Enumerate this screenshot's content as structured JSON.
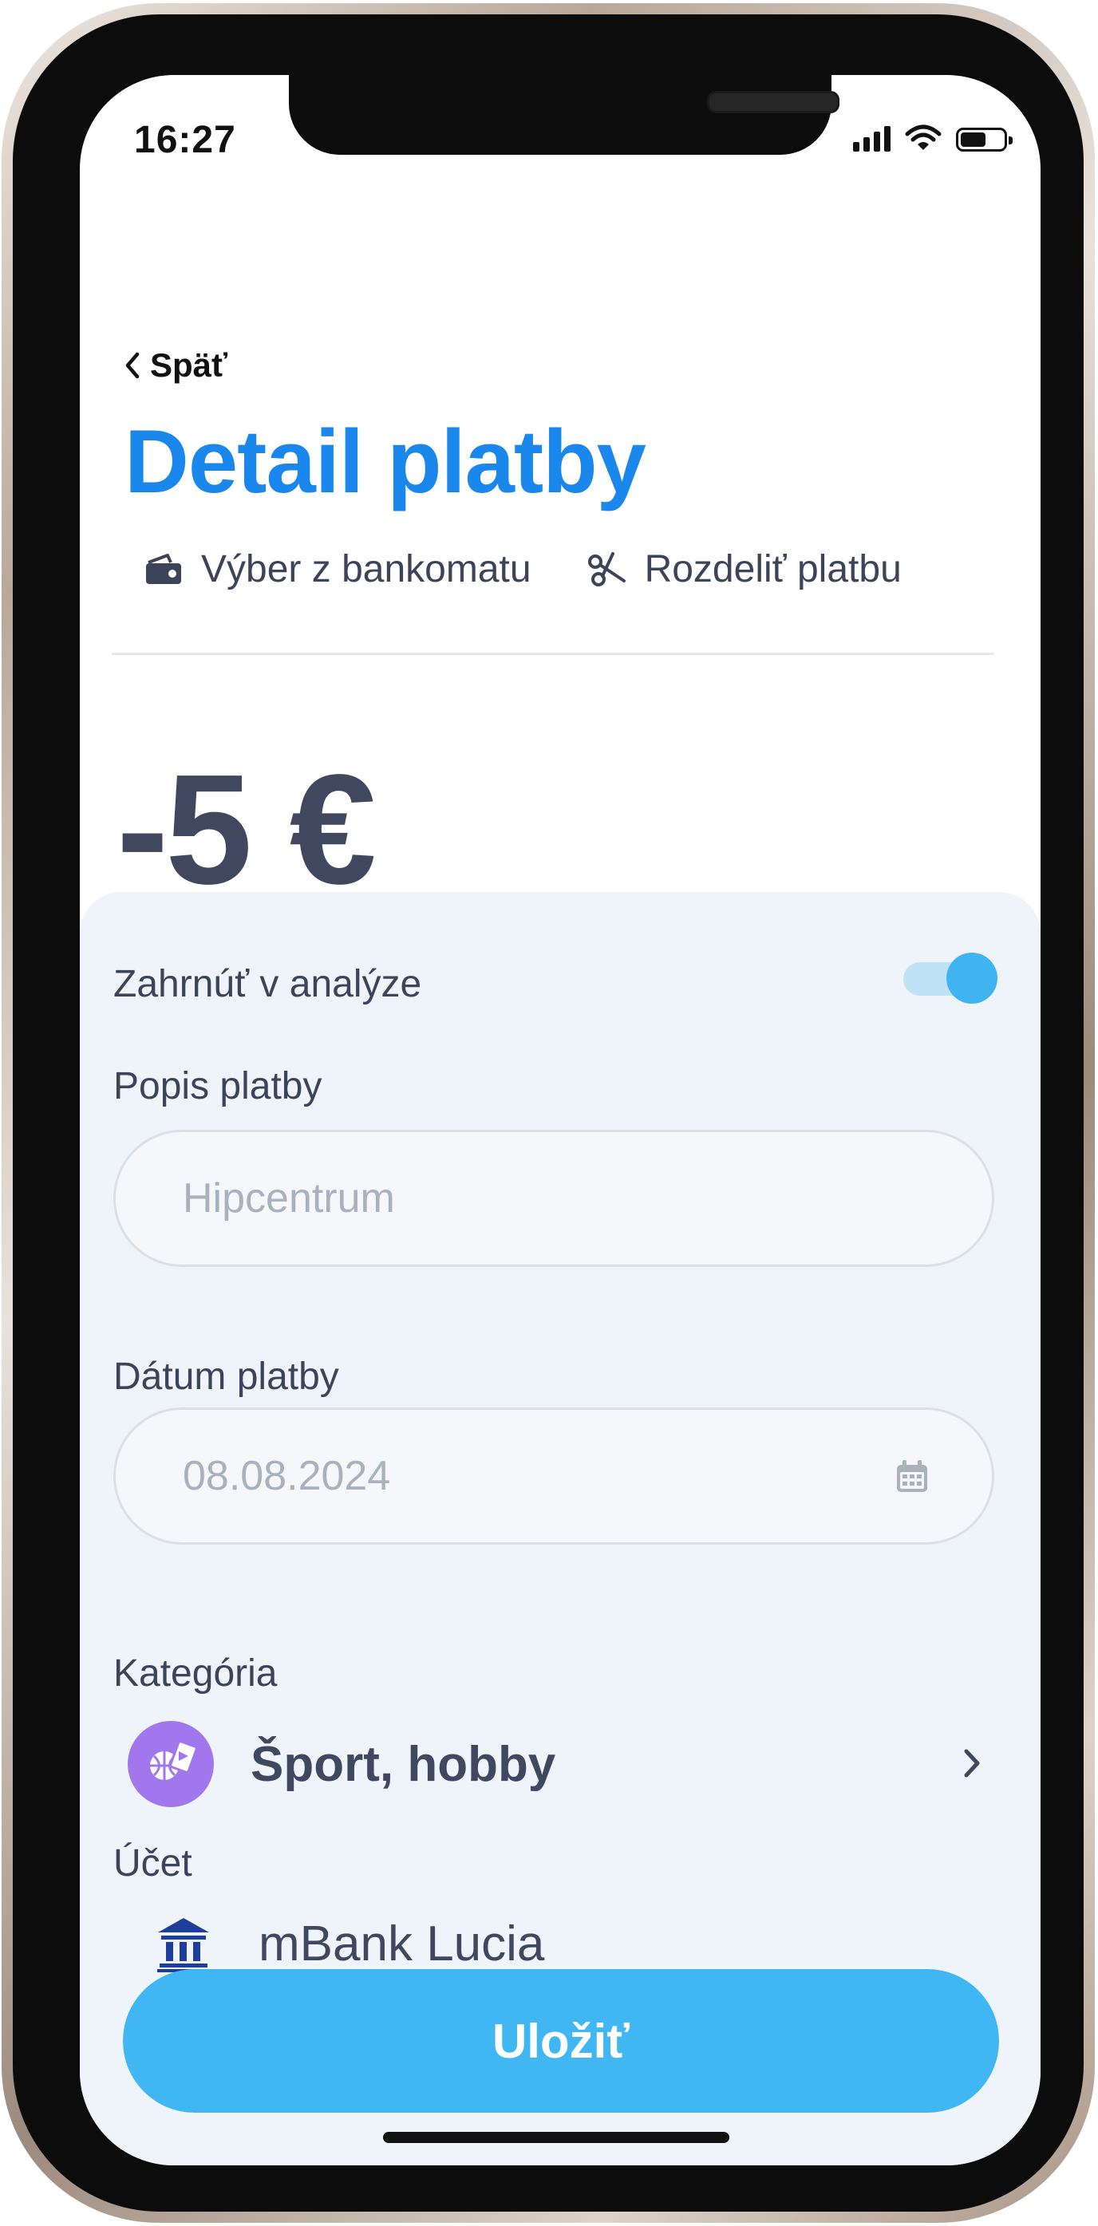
{
  "status_bar": {
    "time": "16:27",
    "signal_icon": "cellular-signal-icon",
    "wifi_icon": "wifi-icon",
    "battery_icon": "battery-icon",
    "battery_level": 0.6
  },
  "header": {
    "back_label": "Späť",
    "back_icon": "chevron-left-icon",
    "title": "Detail platby",
    "title_color": "#1a87ec"
  },
  "actions": [
    {
      "label": "Výber z bankomatu",
      "icon": "cash-withdrawal-icon"
    },
    {
      "label": "Rozdeliť platbu",
      "icon": "scissors-icon"
    }
  ],
  "payment": {
    "amount": "-5 €"
  },
  "form": {
    "include_in_analysis": {
      "label": "Zahrnúť v analýze",
      "enabled": true
    },
    "description": {
      "label": "Popis platby",
      "placeholder": "Hipcentrum"
    },
    "date": {
      "label": "Dátum platby",
      "placeholder": "08.08.2024",
      "icon": "calendar-icon"
    },
    "category": {
      "label": "Kategória",
      "value": "Šport, hobby",
      "icon": "sport-hobby-icon",
      "icon_color": "#a277ee",
      "chevron_icon": "chevron-right-icon"
    },
    "account": {
      "label": "Účet",
      "value": "mBank Lucia",
      "icon": "bank-icon",
      "icon_color": "#1d3e9a"
    }
  },
  "save_button": {
    "label": "Uložiť",
    "color": "#40b6f2"
  }
}
